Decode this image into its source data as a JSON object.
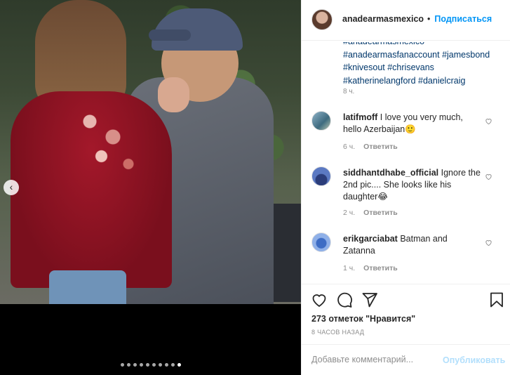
{
  "post": {
    "author": "anadearmasmexico",
    "separator": "•",
    "follow_label": "Подписаться",
    "caption_tags": [
      "#anadearmasmexico",
      "#anadearmasfanaccount #jamesbond",
      "#knivesout #chrisevans",
      "#katherinelangford #danielcraig"
    ],
    "caption_time": "8 ч."
  },
  "media": {
    "prev_glyph": "‹",
    "slide_count": 10,
    "active_slide": 10
  },
  "comments": [
    {
      "user": "latifmoff",
      "text": "I love you very much, hello Azerbaijan🙂",
      "time": "6 ч.",
      "reply": "Ответить"
    },
    {
      "user": "siddhantdhabe_official",
      "text": "Ignore the 2nd pic.... She looks like his daughter😂",
      "time": "2 ч.",
      "reply": "Ответить"
    },
    {
      "user": "erikgarciabat",
      "text": "Batman and Zatanna",
      "time": "1 ч.",
      "reply": "Ответить"
    }
  ],
  "actions": {
    "likes": "273 отметок \"Нравится\"",
    "posted": "8 ЧАСОВ НАЗАД"
  },
  "add_comment": {
    "placeholder": "Добавьте комментарий...",
    "publish_label": "Опубликовать"
  },
  "colors": {
    "accent": "#0095f6",
    "link": "#00376b",
    "publish_disabled": "#b2dffc",
    "muted": "#8e8e8e"
  },
  "icons": [
    "chevron-left-icon",
    "heart-icon",
    "comment-icon",
    "share-icon",
    "bookmark-icon"
  ]
}
